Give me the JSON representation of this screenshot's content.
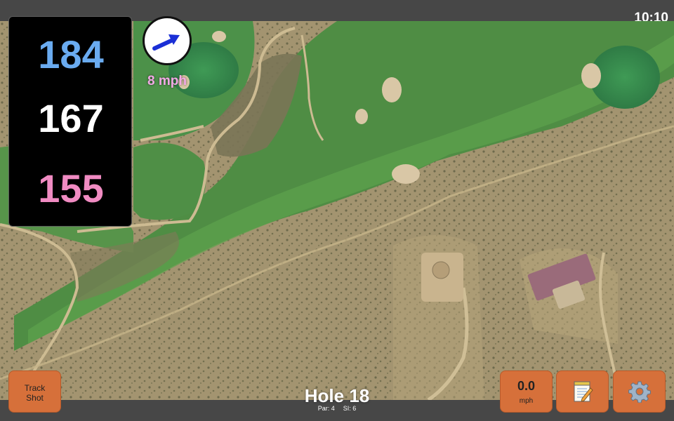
{
  "status_bar": {
    "time": "10:10"
  },
  "yardages": {
    "back": {
      "value": "184",
      "color": "#6aabf0"
    },
    "middle": {
      "value": "167",
      "color": "#ffffff"
    },
    "front": {
      "value": "155",
      "color": "#f08bc2"
    }
  },
  "wind": {
    "icon": "wind-direction-arrow-icon",
    "speed_label": "8 mph",
    "speed_color": "#f2a9e6",
    "arrow_color": "#1a2fd6"
  },
  "hole": {
    "title": "Hole 18",
    "par_label": "Par: 4",
    "si_label": "SI: 6"
  },
  "buttons": {
    "track_shot": "Track\nShot",
    "wind_value": "0.0",
    "wind_unit": "mph",
    "notes_icon": "notepad-icon",
    "settings_icon": "gear-icon"
  },
  "colors": {
    "button_bg": "#d6703a",
    "bar_bg": "#474747"
  }
}
